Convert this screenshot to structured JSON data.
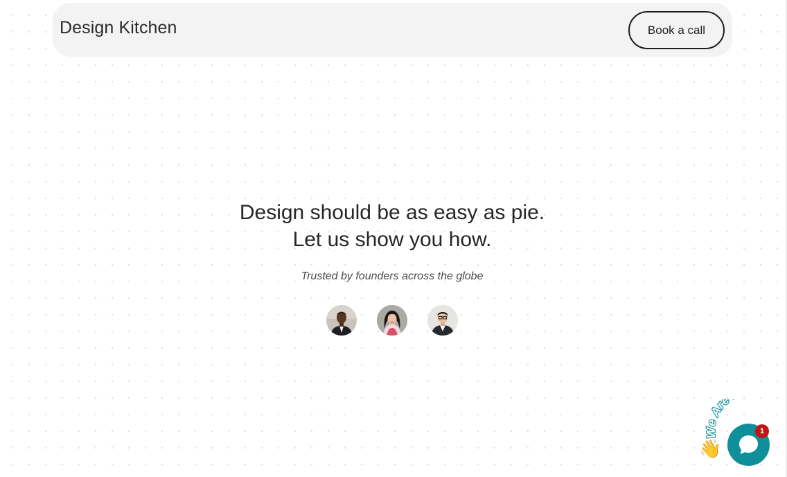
{
  "header": {
    "brand": "Design Kitchen",
    "cta_label": "Book a call"
  },
  "hero": {
    "line_1": "Design should be as easy as pie.",
    "line_2": "Let us show you how.",
    "tagline": "Trusted by founders across the globe"
  },
  "avatars": [
    {
      "icon": "founder-avatar-1"
    },
    {
      "icon": "founder-avatar-2"
    },
    {
      "icon": "founder-avatar-3"
    }
  ],
  "chat": {
    "teaser_text": "We Are Here!",
    "unread_count": "1",
    "wave_icon": "👋",
    "colors": {
      "bubble": "#0f8f9a",
      "badge": "#c41313"
    }
  }
}
